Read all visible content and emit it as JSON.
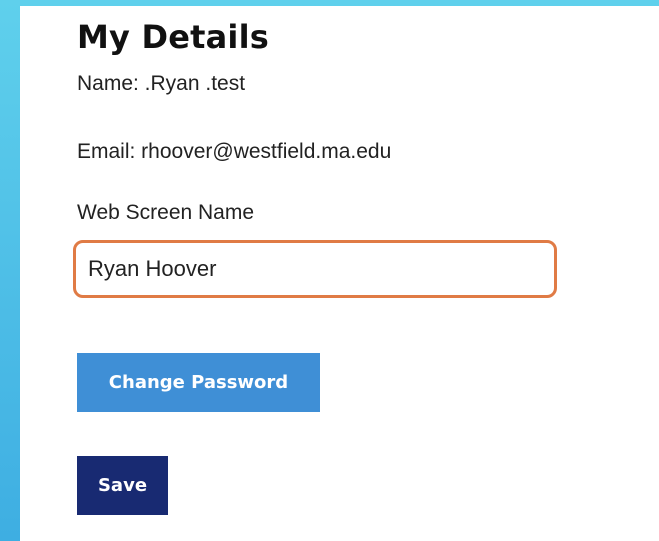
{
  "details": {
    "title": "My Details",
    "name_line": "Name: .Ryan .test",
    "email_line": "Email: rhoover@westfield.ma.edu"
  },
  "screen_name": {
    "label": "Web Screen Name",
    "value": "Ryan Hoover"
  },
  "buttons": {
    "change_password": "Change Password",
    "save": "Save"
  },
  "colors": {
    "background_gradient": [
      "#5fd0ec",
      "#3eaee2"
    ],
    "focus_border": "#e07b45",
    "change_password_button": "#3f8fd6",
    "save_button": "#182a72"
  }
}
